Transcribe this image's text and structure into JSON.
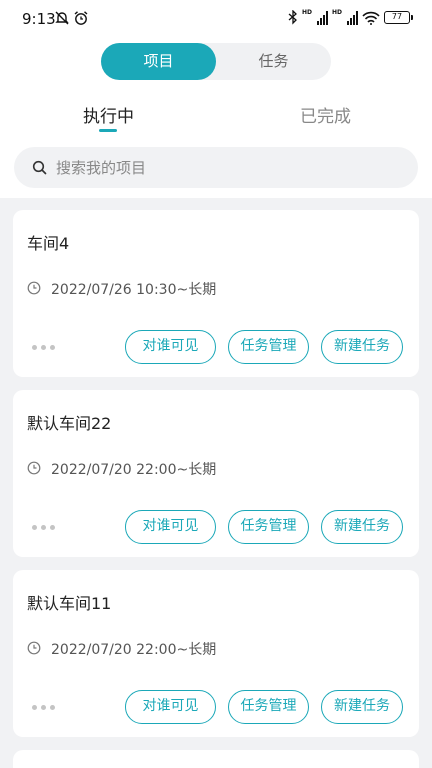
{
  "status_bar": {
    "time": "9:13",
    "signal_label_1": "HD",
    "signal_label_2": "HD",
    "battery": "77"
  },
  "segment": {
    "items": [
      {
        "label": "项目",
        "active": true
      },
      {
        "label": "任务",
        "active": false
      }
    ]
  },
  "tabs": [
    {
      "label": "执行中",
      "active": true
    },
    {
      "label": "已完成",
      "active": false
    }
  ],
  "search": {
    "placeholder": "搜索我的项目",
    "value": ""
  },
  "projects": [
    {
      "title": "车间4",
      "time": "2022/07/26 10:30~长期",
      "buttons": [
        "对谁可见",
        "任务管理",
        "新建任务"
      ]
    },
    {
      "title": "默认车间22",
      "time": "2022/07/20 22:00~长期",
      "buttons": [
        "对谁可见",
        "任务管理",
        "新建任务"
      ]
    },
    {
      "title": "默认车间11",
      "time": "2022/07/20 22:00~长期",
      "buttons": [
        "对谁可见",
        "任务管理",
        "新建任务"
      ]
    }
  ],
  "colors": {
    "accent": "#1ba8b8",
    "background": "#f1f2f4",
    "card": "#ffffff"
  }
}
